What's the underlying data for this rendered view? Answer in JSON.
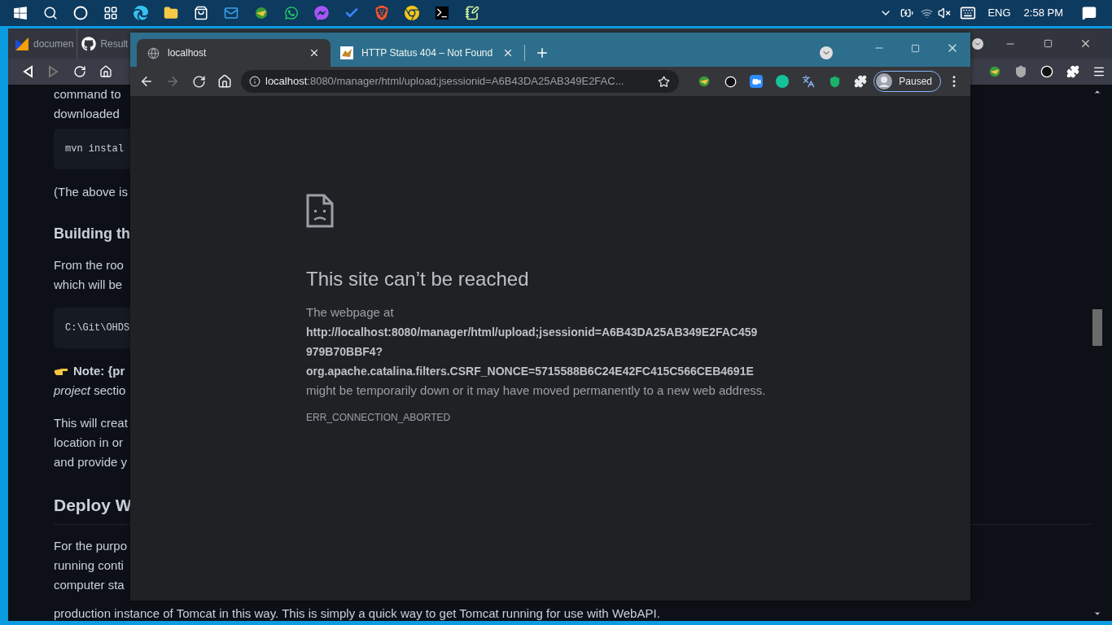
{
  "taskbar": {
    "language": "ENG",
    "time": "2:58 PM"
  },
  "back_window": {
    "tabs": [
      {
        "title": "documen",
        "kind": "docs"
      },
      {
        "title": "Result",
        "kind": "repo"
      }
    ],
    "article": [
      {
        "kind": "paragraph",
        "lines": [
          "command to",
          "downloaded"
        ]
      },
      {
        "kind": "code",
        "lines": [
          "mvn instal"
        ]
      },
      {
        "kind": "paragraph",
        "lines": [
          "(The above is"
        ]
      },
      {
        "kind": "heading",
        "lines": [
          "Building th"
        ]
      },
      {
        "kind": "paragraph",
        "lines": [
          "From the roo",
          "which will be"
        ]
      },
      {
        "kind": "code",
        "lines": [
          "C:\\Git\\OHDS"
        ]
      },
      {
        "kind": "note",
        "lines": [
          "**Note: {pr**",
          "*project* sectio"
        ]
      },
      {
        "kind": "paragraph",
        "lines": [
          "This will creat",
          "location in or",
          "and provide y"
        ]
      },
      {
        "kind": "title",
        "lines": [
          "Deploy W"
        ]
      },
      {
        "kind": "paragraph",
        "lines": [
          "For the purpo",
          "running conti",
          "computer sta"
        ]
      },
      {
        "kind": "tail",
        "lines": [
          "production instance of Tomcat in this way. This is simply a quick way to get Tomcat running for use with WebAPI."
        ]
      }
    ]
  },
  "front_window": {
    "tabs": [
      {
        "title": "localhost",
        "selected": true,
        "kind": "globe"
      },
      {
        "title": "HTTP Status 404 – Not Found",
        "selected": false,
        "kind": "page"
      }
    ],
    "address": {
      "host": "localhost",
      "rest": ":8080/manager/html/upload;jsessionid=A6B43DA25AB349E2FAC..."
    },
    "profile": "Paused",
    "error": {
      "title": "This site can’t be reached",
      "intro": "The webpage at",
      "url_lines": [
        "http://localhost:8080/manager/html/upload;jsessionid=A6B43DA25AB349E2FAC459",
        "979B70BBF4?",
        "org.apache.catalina.filters.CSRF_NONCE=5715588B6C24E42FC415C566CEB4691E"
      ],
      "tail": "might be temporarily down or it may have moved permanently to a new web address.",
      "code": "ERR_CONNECTION_ABORTED"
    }
  }
}
